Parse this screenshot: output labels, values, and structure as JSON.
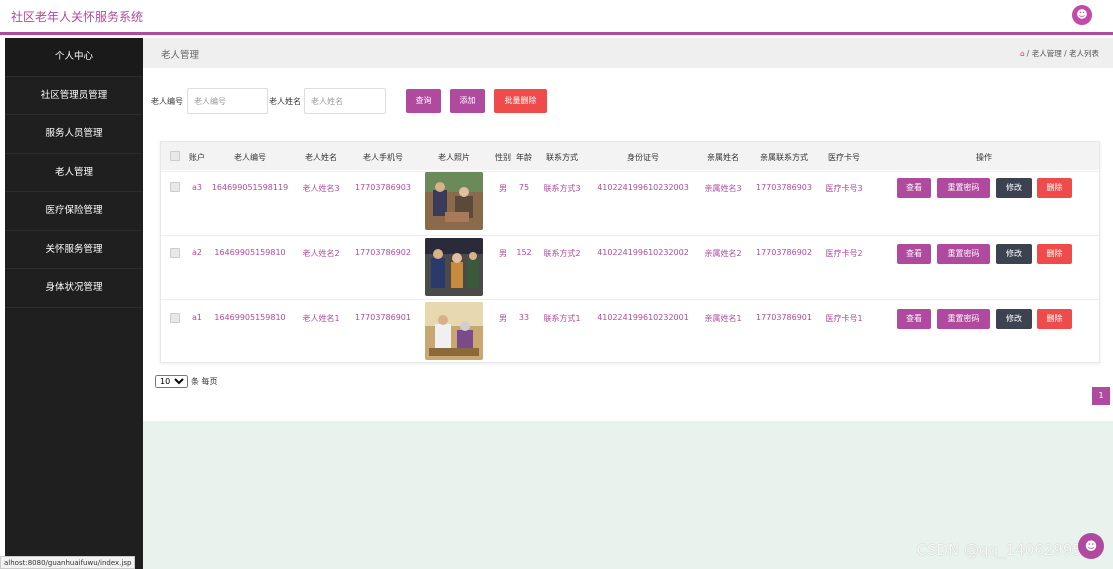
{
  "app": {
    "title": "社区老年人关怀服务系统",
    "avatar_icon": "user-icon"
  },
  "sidebar": {
    "items": [
      {
        "label": "个人中心"
      },
      {
        "label": "社区管理员管理"
      },
      {
        "label": "服务人员管理"
      },
      {
        "label": "老人管理"
      },
      {
        "label": "医疗保险管理"
      },
      {
        "label": "关怀服务管理"
      },
      {
        "label": "身体状况管理"
      }
    ]
  },
  "header": {
    "page_title": "老人管理",
    "breadcrumb": "/ 老人管理 / 老人列表"
  },
  "filters": {
    "elder_no_label": "老人编号",
    "elder_no_placeholder": "老人编号",
    "elder_name_label": "老人姓名",
    "elder_name_placeholder": "老人姓名",
    "search_label": "查询",
    "add_label": "添加",
    "batch_delete_label": "批量删除"
  },
  "table": {
    "columns": [
      "账户",
      "老人编号",
      "老人姓名",
      "老人手机号",
      "老人照片",
      "性别",
      "年龄",
      "联系方式",
      "身份证号",
      "亲属姓名",
      "亲属联系方式",
      "医疗卡号",
      "操作"
    ],
    "rows": [
      {
        "account": "a3",
        "elder_no": "164699051598119",
        "name": "老人姓名3",
        "phone": "17703786903",
        "gender": "男",
        "age": "75",
        "contact": "联系方式3",
        "id_card": "410224199610232003",
        "relative_name": "亲属姓名3",
        "relative_phone": "17703786903",
        "medical_card": "医疗卡号3"
      },
      {
        "account": "a2",
        "elder_no": "16469905159810",
        "name": "老人姓名2",
        "phone": "17703786902",
        "gender": "男",
        "age": "152",
        "contact": "联系方式2",
        "id_card": "410224199610232002",
        "relative_name": "亲属姓名2",
        "relative_phone": "17703786902",
        "medical_card": "医疗卡号2"
      },
      {
        "account": "a1",
        "elder_no": "16469905159810",
        "name": "老人姓名1",
        "phone": "17703786901",
        "gender": "男",
        "age": "33",
        "contact": "联系方式1",
        "id_card": "410224199610232001",
        "relative_name": "亲属姓名1",
        "relative_phone": "17703786901",
        "medical_card": "医疗卡号1"
      }
    ],
    "actions": {
      "view": "查看",
      "reset": "重置密码",
      "edit": "修改",
      "delete": "删除"
    }
  },
  "pagination": {
    "page_size": "10",
    "page_size_suffix": "条 每页",
    "current_page": "1"
  },
  "status_bar": {
    "url": "alhost:8080/guanhuaifuwu/index.jsp"
  },
  "watermark": "CSDN @qq_1406299528",
  "colors": {
    "accent": "#b04a9e",
    "danger": "#f04b4b",
    "dark": "#3c4250",
    "sidebar": "#1f1f1f"
  }
}
